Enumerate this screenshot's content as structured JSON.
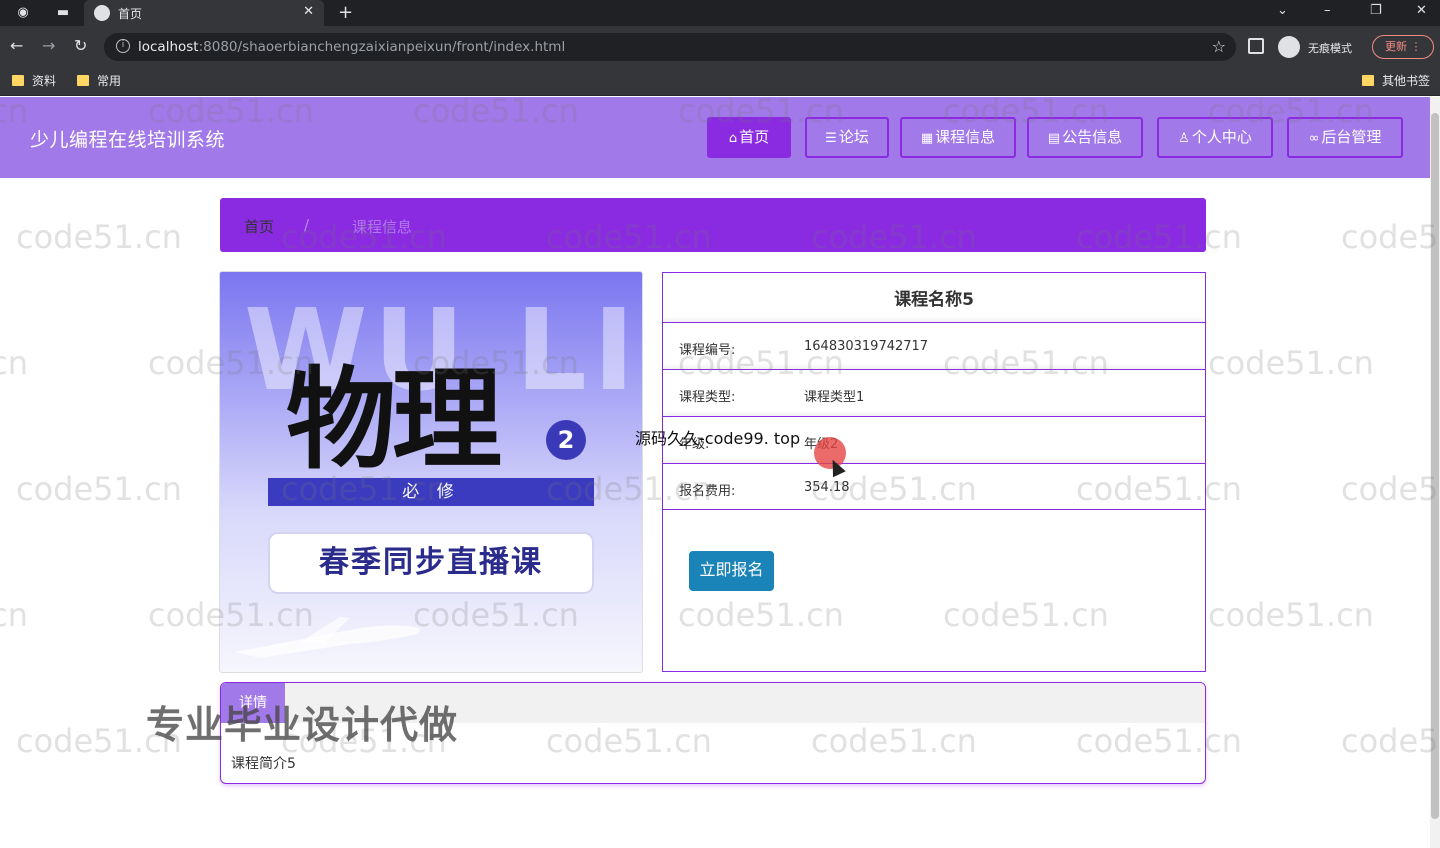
{
  "browser": {
    "tab_title": "首页",
    "url_host": "localhost",
    "url_path": ":8080/shaoerbianchengzaixianpeixun/front/index.html",
    "incognito_label": "无痕模式",
    "update_label": "更新",
    "bookmarks": [
      "资料",
      "常用"
    ],
    "other_bookmarks": "其他书签"
  },
  "site": {
    "title": "少儿编程在线培训系统",
    "nav": [
      {
        "label": "首页",
        "icon": "home-icon"
      },
      {
        "label": "论坛",
        "icon": "forum-icon"
      },
      {
        "label": "课程信息",
        "icon": "course-icon"
      },
      {
        "label": "公告信息",
        "icon": "notice-icon"
      },
      {
        "label": "个人中心",
        "icon": "user-icon"
      },
      {
        "label": "后台管理",
        "icon": "link-icon"
      }
    ]
  },
  "breadcrumb": {
    "home": "首页",
    "separator": "/",
    "current": "课程信息"
  },
  "course_image": {
    "bg_letters": "WU LI",
    "title": "物理",
    "badge": "2",
    "band": "必 修",
    "pill": "春季同步直播课"
  },
  "course": {
    "name": "课程名称5",
    "fields": [
      {
        "label": "课程编号:",
        "value": "164830319742717"
      },
      {
        "label": "课程类型:",
        "value": "课程类型1"
      },
      {
        "label": "年级:",
        "value": "年级2"
      },
      {
        "label": "报名费用:",
        "value": "354.18"
      }
    ],
    "enroll_label": "立即报名"
  },
  "intro": {
    "tab_label": "详情",
    "content": "课程简介5"
  },
  "overlays": {
    "watermark": "code51.cn",
    "promo": "专业毕业设计代做",
    "source_text": "源码久久-code99. top"
  }
}
